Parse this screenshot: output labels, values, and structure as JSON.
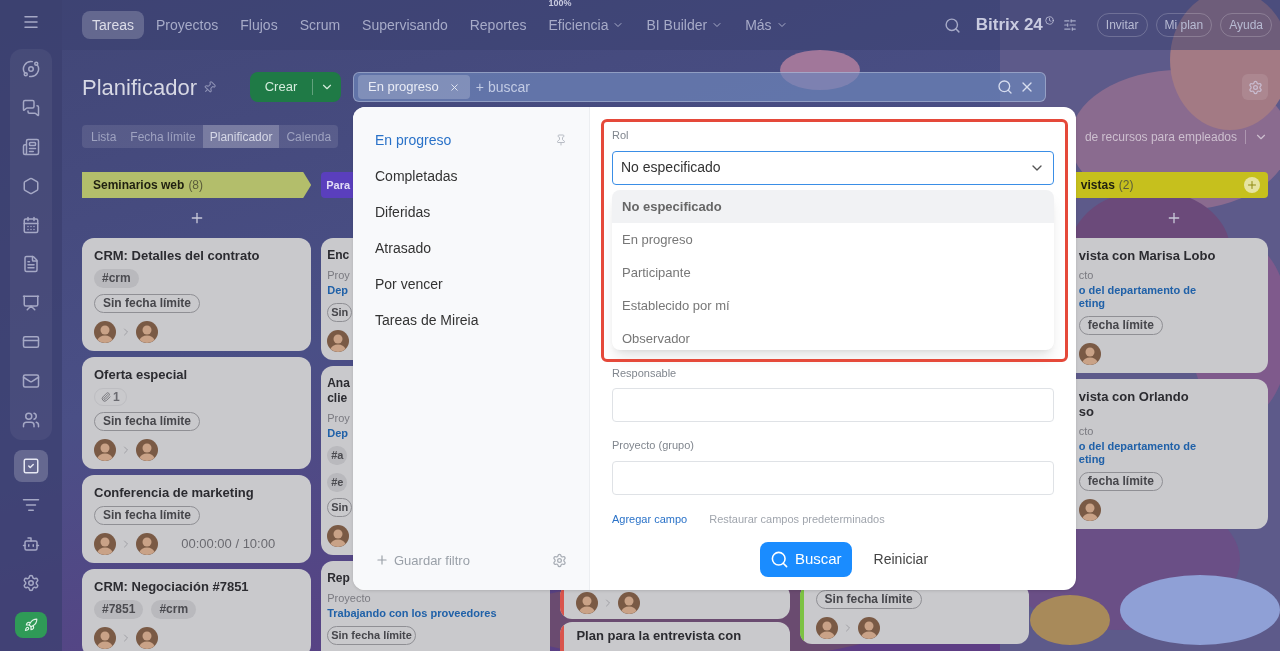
{
  "sidebar": {
    "groups": [
      {
        "kind": "panel",
        "items": [
          {
            "selected": false
          },
          {
            "selected": false
          },
          {
            "selected": false
          },
          {
            "selected": false
          },
          {
            "selected": false
          },
          {
            "selected": false
          },
          {
            "selected": false
          },
          {
            "selected": false
          },
          {
            "selected": false
          },
          {
            "selected": false
          }
        ]
      },
      {
        "kind": "plain",
        "items": [
          {
            "selected": true
          },
          {
            "selected": false
          },
          {
            "selected": false
          },
          {
            "selected": false
          }
        ]
      }
    ]
  },
  "top_nav": {
    "tabs": [
      {
        "label": "Tareas",
        "selected": true,
        "has_menu": false
      },
      {
        "label": "Proyectos",
        "selected": false,
        "has_menu": false
      },
      {
        "label": "Flujos",
        "selected": false,
        "has_menu": false
      },
      {
        "label": "Scrum",
        "selected": false,
        "has_menu": false
      },
      {
        "label": "Supervisando",
        "selected": false,
        "has_menu": false
      },
      {
        "label": "Reportes",
        "selected": false,
        "has_menu": false
      },
      {
        "label": "Eficiencia",
        "badge": "100%",
        "selected": false,
        "has_menu": true
      },
      {
        "label": "BI Builder",
        "selected": false,
        "has_menu": true
      },
      {
        "label": "Más",
        "selected": false,
        "has_menu": true
      }
    ],
    "brand": "Bitrix 24",
    "buttons": [
      "Invitar",
      "Mi plan",
      "Ayuda"
    ]
  },
  "header": {
    "title": "Planificador",
    "create_button": "Crear",
    "filter": {
      "chips": [
        "En progreso"
      ],
      "placeholder": "+ buscar"
    }
  },
  "view_tabs": [
    {
      "label": "Lista",
      "selected": false
    },
    {
      "label": "Fecha límite",
      "selected": false
    },
    {
      "label": "Planificador",
      "selected": true
    },
    {
      "label": "Calenda",
      "selected": false
    }
  ],
  "resource_dropdown": "de recursos para empleados",
  "kanban": {
    "columns": [
      {
        "kind": "full",
        "title": "Seminarios web",
        "count": "(8)",
        "color": "#b3be6b",
        "add_button": false,
        "cards": [
          {
            "title": "CRM: Detalles del contrato",
            "tags": [
              "#crm"
            ],
            "deadline": "Sin fecha límite"
          },
          {
            "title": "Oferta especial",
            "attachments": "1",
            "deadline": "Sin fecha límite"
          },
          {
            "title": "Conferencia de marketing",
            "deadline": "Sin fecha límite",
            "timer": "00:00:00 / 10:00"
          },
          {
            "title": "CRM: Negociación #7851",
            "tags": [
              "#7851",
              "#crm"
            ]
          }
        ]
      },
      {
        "kind": "cut_right",
        "title": "Para",
        "color": "#5a3fbd",
        "add_button": false,
        "cards": [
          {
            "title": "Enc",
            "project_label": "Proy",
            "project": "Dep",
            "deadline": "Sin"
          },
          {
            "title": "Ana\nclie",
            "project_label": "Proy",
            "project": "Dep",
            "tags": [
              "#a",
              "#e"
            ],
            "deadline": "Sin"
          },
          {
            "title": "Rep",
            "project_label": "Proyecto",
            "project": "Trabajando con los proveedores",
            "deadline": "Sin fecha límite"
          }
        ]
      },
      {
        "kind": "cut_top",
        "cards": [
          {
            "color": "#d9544c"
          },
          {
            "title": "Plan para la entrevista con",
            "color": "#d9544c"
          }
        ]
      },
      {
        "kind": "cut_top",
        "cards": [
          {
            "deadline": "Sin fecha límite",
            "color": "#7cc243"
          }
        ]
      },
      {
        "kind": "cut_left",
        "title": "vistas",
        "count": "(2)",
        "color": "#c6c01d",
        "add_button": true,
        "cards": [
          {
            "title": "vista con Marisa Lobo",
            "project_label": "cto",
            "project": "o del departamento de\neting",
            "deadline": "fecha límite"
          },
          {
            "title": "vista con Orlando\nso",
            "project_label": "cto",
            "project": "o del departamento de\neting",
            "deadline": "fecha límite"
          }
        ]
      }
    ]
  },
  "filter_popup": {
    "presets": [
      {
        "label": "En progreso",
        "selected": true,
        "pinned": true
      },
      {
        "label": "Completadas",
        "selected": false,
        "pinned": false
      },
      {
        "label": "Diferidas",
        "selected": false,
        "pinned": false
      },
      {
        "label": "Atrasado",
        "selected": false,
        "pinned": false
      },
      {
        "label": "Por vencer",
        "selected": false,
        "pinned": false
      },
      {
        "label": "Tareas de Mireia",
        "selected": false,
        "pinned": false
      }
    ],
    "save_filter": "Guardar filtro",
    "role_field": {
      "label": "Rol",
      "value": "No especificado",
      "expanded": true,
      "options": [
        {
          "label": "No especificado",
          "selected": true
        },
        {
          "label": "En progreso",
          "selected": false
        },
        {
          "label": "Participante",
          "selected": false
        },
        {
          "label": "Establecido por mí",
          "selected": false
        },
        {
          "label": "Observador",
          "selected": false
        }
      ]
    },
    "fields": [
      {
        "label": "Responsable"
      },
      {
        "label": "Proyecto (grupo)"
      }
    ],
    "add_field": "Agregar campo",
    "restore_fields": "Restaurar campos predeterminados",
    "search_button": "Buscar",
    "reset_button": "Reiniciar",
    "highlighted": true
  }
}
